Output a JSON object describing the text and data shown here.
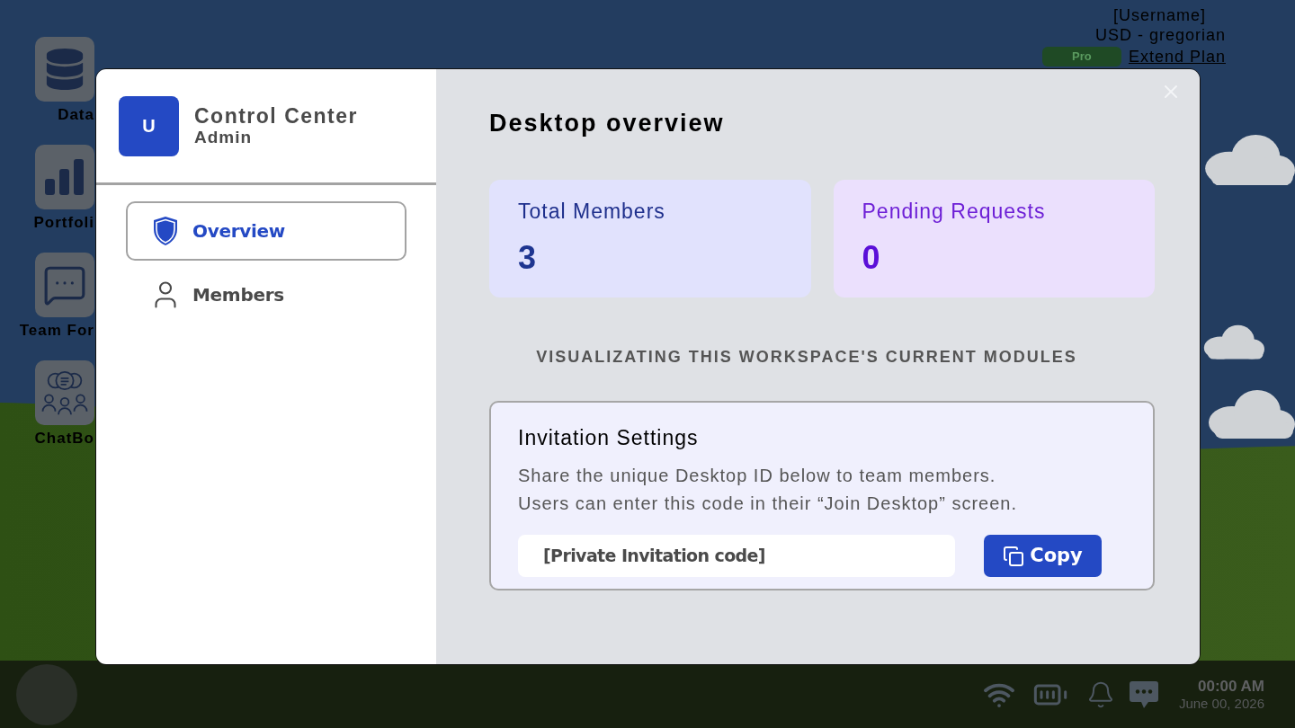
{
  "desktop_icons": [
    {
      "label": "Data"
    },
    {
      "label": "Portfoli"
    },
    {
      "label": "Team For"
    },
    {
      "label": "ChatBo"
    }
  ],
  "account": {
    "username": "[Username]",
    "currency": "USD - gregorian",
    "plan_badge": "Pro",
    "plan_link": "Extend Plan"
  },
  "dialog": {
    "logo_letter": "U",
    "title": "Control Center",
    "subtitle": "Admin",
    "nav": [
      {
        "label": "Overview",
        "selected": true
      },
      {
        "label": "Members",
        "selected": false
      }
    ],
    "heading": "Desktop overview",
    "stats": [
      {
        "label": "Total Members",
        "value": "3"
      },
      {
        "label": "Pending Requests",
        "value": "0"
      }
    ],
    "caption": "VISUALIZATING THIS WORKSPACE'S CURRENT MODULES",
    "invitation": {
      "title": "Invitation Settings",
      "description": "Share the unique Desktop ID below to team members.\nUsers can enter this code in their “Join Desktop” screen.",
      "code": "[Private Invitation code]",
      "copy_button": "Copy"
    }
  },
  "taskbar": {
    "time": "00:00 AM",
    "date": "June 00, 2026"
  }
}
